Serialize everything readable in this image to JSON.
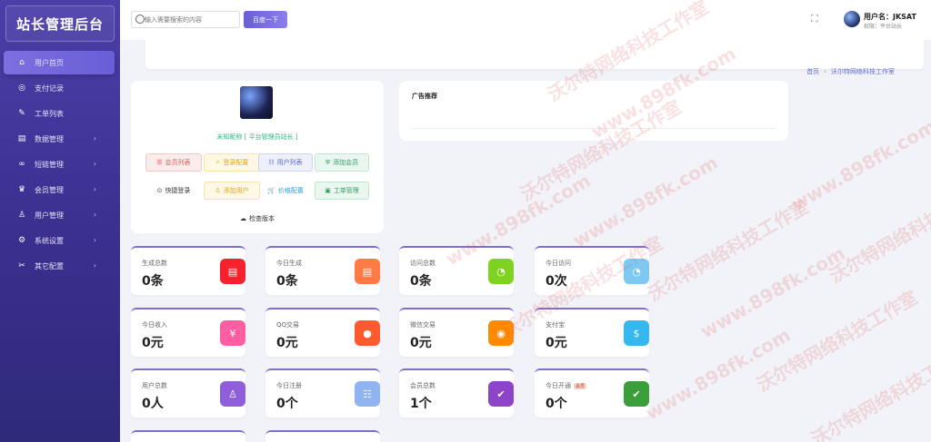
{
  "sidebar": {
    "brand": "站长管理后台",
    "items": [
      {
        "label": "用户首页",
        "icon": "home-icon",
        "glyph": "⌂",
        "active": true,
        "has_children": false
      },
      {
        "label": "支付记录",
        "icon": "payment-icon",
        "glyph": "◎",
        "active": false,
        "has_children": false
      },
      {
        "label": "工单列表",
        "icon": "ticket-icon",
        "glyph": "✎",
        "active": false,
        "has_children": false
      },
      {
        "label": "数据管理",
        "icon": "data-icon",
        "glyph": "▤",
        "active": false,
        "has_children": true
      },
      {
        "label": "短链管理",
        "icon": "link-icon",
        "glyph": "∞",
        "active": false,
        "has_children": true
      },
      {
        "label": "会员管理",
        "icon": "member-icon",
        "glyph": "♛",
        "active": false,
        "has_children": true
      },
      {
        "label": "用户管理",
        "icon": "user-icon",
        "glyph": "♙",
        "active": false,
        "has_children": true
      },
      {
        "label": "系统设置",
        "icon": "settings-icon",
        "glyph": "⚙",
        "active": false,
        "has_children": true
      },
      {
        "label": "其它配置",
        "icon": "tools-icon",
        "glyph": "✂",
        "active": false,
        "has_children": true
      }
    ]
  },
  "topbar": {
    "search_placeholder": "输入需要搜索的内容",
    "search_button": "百度一下",
    "user_name": "用户名：JKSAT",
    "user_role": "权限：平台站长"
  },
  "breadcrumb": {
    "home": "首页",
    "current": "沃尔特网络科技工作室"
  },
  "profile": {
    "name": "未知昵称 [ 平台管理员站长 ]",
    "buttons": [
      {
        "label": "会员列表",
        "icon": "list-icon",
        "glyph": "☰",
        "style": "red"
      },
      {
        "label": "登录配置",
        "icon": "gear-icon",
        "glyph": "✧",
        "style": "yellow"
      },
      {
        "label": "用户列表",
        "icon": "users-icon",
        "glyph": "☷",
        "style": "blue"
      },
      {
        "label": "添加会员",
        "icon": "shield-icon",
        "glyph": "⛨",
        "style": "green"
      },
      {
        "label": "快捷登录",
        "icon": "clock-icon",
        "glyph": "⊙",
        "style": "plain"
      },
      {
        "label": "添加用户",
        "icon": "add-user-icon",
        "glyph": "♙",
        "style": "yellow"
      },
      {
        "label": "价格配置",
        "icon": "cart-icon",
        "glyph": "🛒",
        "style": "cyan"
      },
      {
        "label": "工单管理",
        "icon": "ticket-icon",
        "glyph": "▣",
        "style": "green"
      },
      {
        "label": "检查版本",
        "icon": "cloud-icon",
        "glyph": "☁",
        "style": "plain"
      }
    ]
  },
  "ad": {
    "title": "广告推荐"
  },
  "stats": [
    {
      "label": "生成总数",
      "value": "0条",
      "icon": "document-icon",
      "glyph": "▤",
      "color": "#f5222d"
    },
    {
      "label": "今日生成",
      "value": "0条",
      "icon": "document-icon",
      "glyph": "▤",
      "color": "#ff7a45"
    },
    {
      "label": "访问总数",
      "value": "0条",
      "icon": "clock-icon",
      "glyph": "◔",
      "color": "#7ed321"
    },
    {
      "label": "今日访问",
      "value": "0次",
      "icon": "clock-icon",
      "glyph": "◔",
      "color": "#7ec8f2"
    },
    {
      "label": "今日收入",
      "value": "0元",
      "icon": "yen-icon",
      "glyph": "¥",
      "color": "#ff5fa2"
    },
    {
      "label": "QQ交易",
      "value": "0元",
      "icon": "qq-icon",
      "glyph": "●",
      "color": "#ff5b2e"
    },
    {
      "label": "微信交易",
      "value": "0元",
      "icon": "wechat-icon",
      "glyph": "◉",
      "color": "#ff8a00"
    },
    {
      "label": "支付宝",
      "value": "0元",
      "icon": "dollar-icon",
      "glyph": "$",
      "color": "#36b7f0"
    },
    {
      "label": "用户总数",
      "value": "0人",
      "icon": "user-icon",
      "glyph": "♙",
      "color": "#8e5fd8"
    },
    {
      "label": "今日注册",
      "value": "0个",
      "icon": "users-icon",
      "glyph": "☷",
      "color": "#8fb4f0"
    },
    {
      "label": "会员总数",
      "value": "1个",
      "icon": "shield-check-icon",
      "glyph": "✔",
      "color": "#8e44c9"
    },
    {
      "label": "今日开通",
      "value": "0个",
      "icon": "shield-check-icon",
      "glyph": "✔",
      "color": "#3a9e3a",
      "badge": "会员"
    }
  ],
  "watermark": {
    "text_a": "沃尔特网络科技工作室",
    "text_b": "www.898fk.com"
  }
}
